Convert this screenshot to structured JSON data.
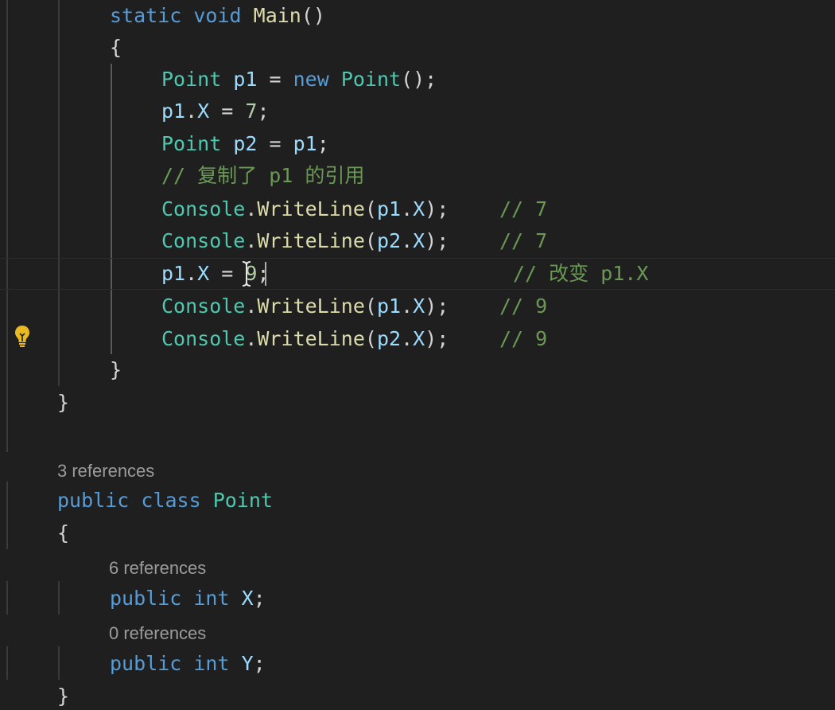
{
  "editor": {
    "language": "C#",
    "theme_colors": {
      "background": "#1f1f1f",
      "keyword": "#569cd6",
      "type": "#4ec9b0",
      "method": "#dcdcaa",
      "variable": "#9cdcfe",
      "number": "#b5cea8",
      "comment": "#6a9955",
      "codelens": "#9b9b9b",
      "lightbulb": "#e8b923"
    },
    "lines": {
      "main_sig": {
        "kw1": "static",
        "kw2": "void",
        "name": "Main",
        "paren": "()"
      },
      "main_open": "{",
      "l1": {
        "type": "Point",
        "var": "p1",
        "eq": " = ",
        "kw": "new",
        "type2": "Point",
        "tail": "();"
      },
      "l2": {
        "var": "p1",
        "dot": ".",
        "prop": "X",
        "eq": " = ",
        "num": "7",
        "semi": ";"
      },
      "l3": {
        "type": "Point",
        "var": "p2",
        "eq": " = ",
        "var2": "p1",
        "semi": ";"
      },
      "l4": {
        "comment": "// 复制了 p1 的引用"
      },
      "l5": {
        "cls": "Console",
        "dot": ".",
        "fn": "WriteLine",
        "open": "(",
        "var": "p1",
        "dot2": ".",
        "prop": "X",
        "close": ");",
        "comment": "// 7"
      },
      "l6": {
        "cls": "Console",
        "dot": ".",
        "fn": "WriteLine",
        "open": "(",
        "var": "p2",
        "dot2": ".",
        "prop": "X",
        "close": ");",
        "comment": "// 7"
      },
      "l7": {
        "var": "p1",
        "dot": ".",
        "prop": "X",
        "eq": " = ",
        "num": "9",
        "semi": ";",
        "comment": "// 改变 p1.X"
      },
      "l8": {
        "cls": "Console",
        "dot": ".",
        "fn": "WriteLine",
        "open": "(",
        "var": "p1",
        "dot2": ".",
        "prop": "X",
        "close": ");",
        "comment": "// 9"
      },
      "l9": {
        "cls": "Console",
        "dot": ".",
        "fn": "WriteLine",
        "open": "(",
        "var": "p2",
        "dot2": ".",
        "prop": "X",
        "close": ");",
        "comment": "// 9"
      },
      "main_close": "}",
      "program_close": "}",
      "point_refs": "3 references",
      "point_decl": {
        "kw1": "public",
        "kw2": "class",
        "name": "Point"
      },
      "point_open": "{",
      "x_refs": "6 references",
      "x_decl": {
        "kw1": "public",
        "kw2": "int",
        "name": "X",
        "semi": ";"
      },
      "y_refs": "0 references",
      "y_decl": {
        "kw1": "public",
        "kw2": "int",
        "name": "Y",
        "semi": ";"
      },
      "point_close": "}"
    },
    "icons": {
      "lightbulb": "lightbulb-icon",
      "text_cursor": "text-ibeam-cursor-icon"
    }
  }
}
